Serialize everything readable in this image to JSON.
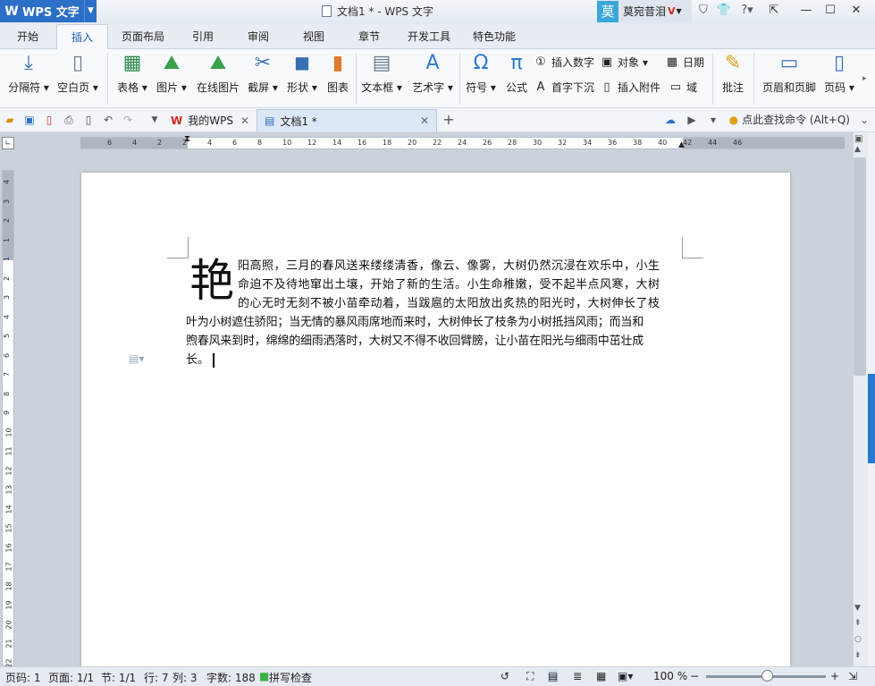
{
  "titlebar": {
    "app_name": "WPS 文字",
    "app_logo": "W",
    "window_title": "文档1 * - WPS 文字",
    "user_avatar": "莫",
    "user_name": "莫宛昔泪",
    "user_vip": "V"
  },
  "tabs": [
    "开始",
    "插入",
    "页面布局",
    "引用",
    "审阅",
    "视图",
    "章节",
    "开发工具",
    "特色功能"
  ],
  "active_tab": "插入",
  "ribbon": {
    "large": [
      {
        "label": "分隔符",
        "icon": "page-break-icon"
      },
      {
        "label": "空白页",
        "icon": "blank-page-icon"
      },
      {
        "label": "表格",
        "icon": "table-icon"
      },
      {
        "label": "图片",
        "icon": "picture-icon"
      },
      {
        "label": "在线图片",
        "icon": "online-picture-icon"
      },
      {
        "label": "截屏",
        "icon": "screenshot-icon"
      },
      {
        "label": "形状",
        "icon": "shapes-icon"
      },
      {
        "label": "图表",
        "icon": "chart-icon"
      },
      {
        "label": "文本框",
        "icon": "textbox-icon"
      },
      {
        "label": "艺术字",
        "icon": "wordart-icon"
      },
      {
        "label": "符号",
        "icon": "omega-icon"
      },
      {
        "label": "公式",
        "icon": "pi-icon"
      },
      {
        "label": "批注",
        "icon": "comment-icon"
      },
      {
        "label": "页眉和页脚",
        "icon": "header-footer-icon"
      },
      {
        "label": "页码",
        "icon": "page-number-icon"
      }
    ],
    "small": [
      {
        "label": "插入数字",
        "icon": "number-icon"
      },
      {
        "label": "对象",
        "icon": "object-icon"
      },
      {
        "label": "日期",
        "icon": "calendar-icon"
      },
      {
        "label": "首字下沉",
        "icon": "dropcap-icon"
      },
      {
        "label": "插入附件",
        "icon": "attachment-icon"
      },
      {
        "label": "域",
        "icon": "field-icon"
      }
    ]
  },
  "doc_tabs": [
    {
      "label": "我的WPS"
    },
    {
      "label": "文档1 *"
    }
  ],
  "command_search": "点此查找命令 (Alt+Q)",
  "ruler_h": [
    "6",
    "4",
    "2",
    "2",
    "4",
    "6",
    "8",
    "10",
    "12",
    "14",
    "16",
    "18",
    "20",
    "22",
    "24",
    "26",
    "28",
    "30",
    "32",
    "34",
    "36",
    "38",
    "40",
    "42",
    "44",
    "46"
  ],
  "ruler_v": [
    "4",
    "3",
    "2",
    "1",
    "1",
    "2",
    "3",
    "4",
    "5",
    "6",
    "7",
    "8",
    "9",
    "10",
    "11",
    "12",
    "13",
    "14",
    "15",
    "16",
    "17",
    "18",
    "19",
    "20",
    "21",
    "22"
  ],
  "document": {
    "drop_cap": "艳",
    "lines": [
      "阳高照，三月的春风送来缕缕清香，像云、像雾，大树仍然沉浸在欢乐中，小生",
      "命迫不及待地窜出土壤，开始了新的生活。小生命稚嫩，受不起半点风寒，大树",
      "的心无时无刻不被小苗牵动着，当跋扈的太阳放出炙热的阳光时，大树伸长了枝",
      "叶为小树遮住骄阳；当无情的暴风雨席地而来时，大树伸长了枝条为小树抵挡风雨；而当和",
      "煦春风来到时，绵绵的细雨洒落时，大树又不得不收回臂膀，让小苗在阳光与细雨中茁壮成",
      "长。"
    ]
  },
  "status": {
    "page": "页码: 1",
    "pages": "页面: 1/1",
    "section": "节: 1/1",
    "row": "行: 7",
    "col": "列: 3",
    "words": "字数: 188",
    "spell": "拼写检查",
    "zoom": "100 %"
  },
  "colors": {
    "accent": "#2c6fc6",
    "vip": "#d0271c",
    "spell_ok": "#3cb043"
  }
}
